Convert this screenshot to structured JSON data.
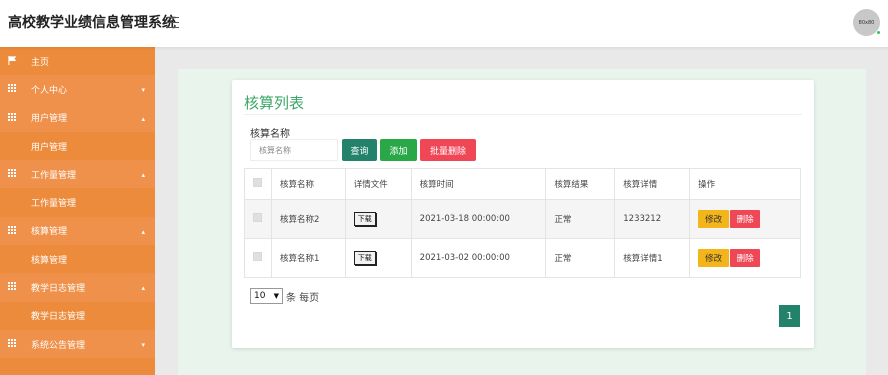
{
  "header": {
    "app_title": "高校教学业绩信息管理系统",
    "avatar_text": "80x80"
  },
  "sidebar": {
    "items": [
      {
        "label": "主页",
        "kind": "top",
        "icon": "flag-icon"
      },
      {
        "label": "个人中心",
        "kind": "group",
        "icon": "grid-icon",
        "caret": "▾"
      },
      {
        "label": "用户管理",
        "kind": "group",
        "icon": "grid-icon",
        "caret": "▴"
      },
      {
        "label": "用户管理",
        "kind": "sub"
      },
      {
        "label": "工作量管理",
        "kind": "group",
        "icon": "grid-icon",
        "caret": "▴"
      },
      {
        "label": "工作量管理",
        "kind": "sub"
      },
      {
        "label": "核算管理",
        "kind": "group",
        "icon": "grid-icon",
        "caret": "▴"
      },
      {
        "label": "核算管理",
        "kind": "sub"
      },
      {
        "label": "教学日志管理",
        "kind": "group",
        "icon": "grid-icon",
        "caret": "▴"
      },
      {
        "label": "教学日志管理",
        "kind": "sub"
      },
      {
        "label": "系统公告管理",
        "kind": "group",
        "icon": "grid-icon",
        "caret": "▾"
      }
    ]
  },
  "main": {
    "title": "核算列表",
    "search": {
      "label": "核算名称",
      "placeholder": "核算名称",
      "value": ""
    },
    "buttons": {
      "query": "查询",
      "add": "添加",
      "batch_delete": "批量删除"
    },
    "table": {
      "columns": [
        "核算名称",
        "详情文件",
        "核算时间",
        "核算结果",
        "核算详情",
        "操作"
      ],
      "rows": [
        {
          "name": "核算名称2",
          "file_button": "下载",
          "time": "2021-03-18 00:00:00",
          "result": "正常",
          "detail": "1233212"
        },
        {
          "name": "核算名称1",
          "file_button": "下载",
          "time": "2021-03-02 00:00:00",
          "result": "正常",
          "detail": "核算详情1"
        }
      ],
      "edit_label": "修改",
      "delete_label": "删除"
    },
    "pagination": {
      "page_size": "10",
      "page_size_label": "条 每页",
      "current_page": "1"
    }
  },
  "colors": {
    "sidebar": "#ed8b3c",
    "accent_green": "#23836a",
    "add_green": "#2aa847",
    "danger": "#f04757",
    "warning": "#f3b51a",
    "title_green": "#3aa767"
  }
}
